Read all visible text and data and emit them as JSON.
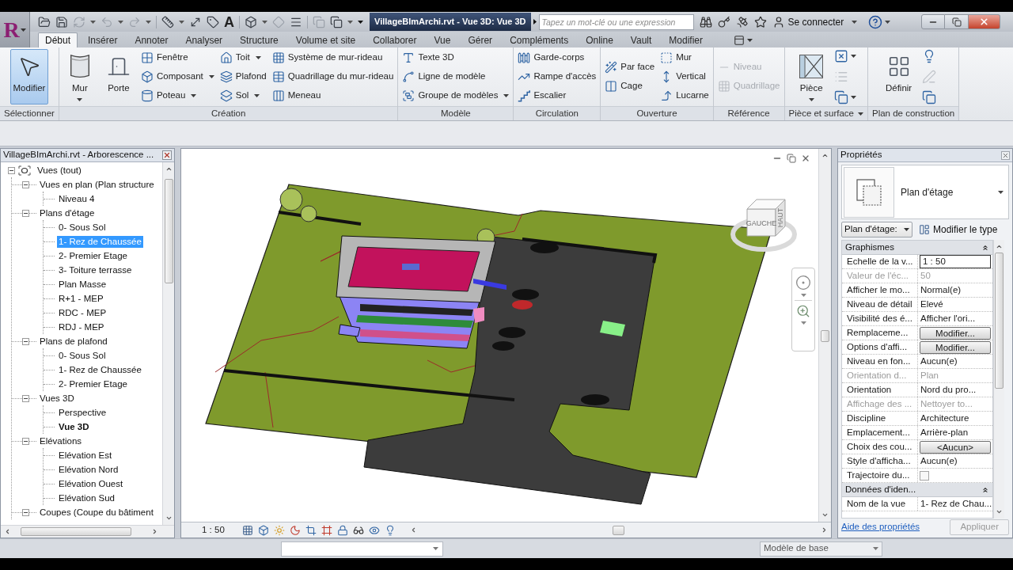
{
  "app_menu": {
    "logo": "R"
  },
  "quick_access": {
    "text_tool": "A"
  },
  "title_bar": {
    "title": "VillageBImArchi.rvt - Vue 3D: Vue 3D",
    "search": {
      "placeholder": "Tapez un mot-clé ou une expression"
    },
    "sign_in": "Se connecter"
  },
  "ribbon": {
    "tabs": [
      {
        "label": "Début",
        "selected": true
      },
      {
        "label": "Insérer",
        "selected": false
      },
      {
        "label": "Annoter",
        "selected": false
      },
      {
        "label": "Analyser",
        "selected": false
      },
      {
        "label": "Structure",
        "selected": false
      },
      {
        "label": "Volume et site",
        "selected": false
      },
      {
        "label": "Collaborer",
        "selected": false
      },
      {
        "label": "Vue",
        "selected": false
      },
      {
        "label": "Gérer",
        "selected": false
      },
      {
        "label": "Compléments",
        "selected": false
      },
      {
        "label": "Online",
        "selected": false
      },
      {
        "label": "Vault",
        "selected": false
      },
      {
        "label": "Modifier",
        "selected": false
      }
    ],
    "panels": [
      {
        "title": "Sélectionner",
        "menu": false,
        "columns": [
          {
            "kind": "large",
            "items": [
              {
                "label": "Modifier",
                "dropdown": false,
                "active": true
              }
            ]
          }
        ]
      },
      {
        "title": "Création",
        "menu": false,
        "columns": [
          {
            "kind": "large",
            "items": [
              {
                "label": "Mur",
                "dropdown": true,
                "active": false
              }
            ]
          },
          {
            "kind": "large",
            "items": [
              {
                "label": "Porte",
                "dropdown": false,
                "active": false
              }
            ]
          },
          {
            "kind": "small",
            "items": [
              {
                "label": "Fenêtre",
                "dropdown": false,
                "disabled": false
              },
              {
                "label": "Composant",
                "dropdown": true,
                "disabled": false
              },
              {
                "label": "Poteau",
                "dropdown": true,
                "disabled": false
              }
            ]
          },
          {
            "kind": "small",
            "items": [
              {
                "label": "Toit",
                "dropdown": true,
                "disabled": false
              },
              {
                "label": "Plafond",
                "dropdown": false,
                "disabled": false
              },
              {
                "label": "Sol",
                "dropdown": true,
                "disabled": false
              }
            ]
          },
          {
            "kind": "small",
            "items": [
              {
                "label": "Système de mur-rideau",
                "dropdown": false,
                "disabled": false
              },
              {
                "label": "Quadrillage du mur-rideau",
                "dropdown": false,
                "disabled": false
              },
              {
                "label": "Meneau",
                "dropdown": false,
                "disabled": false
              }
            ]
          }
        ]
      },
      {
        "title": "Modèle",
        "menu": false,
        "columns": [
          {
            "kind": "small",
            "items": [
              {
                "label": "Texte 3D",
                "dropdown": false,
                "disabled": false
              },
              {
                "label": "Ligne de modèle",
                "dropdown": false,
                "disabled": false
              },
              {
                "label": "Groupe de modèles",
                "dropdown": true,
                "disabled": false
              }
            ]
          }
        ]
      },
      {
        "title": "Circulation",
        "menu": false,
        "columns": [
          {
            "kind": "small",
            "items": [
              {
                "label": "Garde-corps",
                "dropdown": false,
                "disabled": false
              },
              {
                "label": "Rampe d'accès",
                "dropdown": false,
                "disabled": false
              },
              {
                "label": "Escalier",
                "dropdown": false,
                "disabled": false
              }
            ]
          }
        ]
      },
      {
        "title": "Ouverture",
        "menu": false,
        "columns": [
          {
            "kind": "small",
            "items": [
              {
                "label": "Par face",
                "dropdown": false,
                "disabled": false
              },
              {
                "label": "Cage",
                "dropdown": false,
                "disabled": false
              }
            ]
          },
          {
            "kind": "small",
            "items": [
              {
                "label": "Mur",
                "dropdown": false,
                "disabled": false
              },
              {
                "label": "Vertical",
                "dropdown": false,
                "disabled": false
              },
              {
                "label": "Lucarne",
                "dropdown": false,
                "disabled": false
              }
            ]
          }
        ]
      },
      {
        "title": "Référence",
        "menu": false,
        "columns": [
          {
            "kind": "small",
            "items": [
              {
                "label": "Niveau",
                "dropdown": false,
                "disabled": true
              },
              {
                "label": "Quadrillage",
                "dropdown": false,
                "disabled": true
              }
            ]
          }
        ]
      },
      {
        "title": "Pièce et surface",
        "menu": true,
        "columns": [
          {
            "kind": "large",
            "items": [
              {
                "label": "Pièce",
                "dropdown": true,
                "active": false
              }
            ]
          },
          {
            "kind": "icon",
            "items": [
              {
                "dropdown": true,
                "disabled": false
              },
              {
                "dropdown": false,
                "disabled": true
              },
              {
                "dropdown": true,
                "disabled": false
              }
            ]
          }
        ]
      },
      {
        "title": "Plan de construction",
        "menu": false,
        "columns": [
          {
            "kind": "large",
            "items": [
              {
                "label": "Définir",
                "dropdown": false,
                "active": false
              }
            ]
          },
          {
            "kind": "icon",
            "items": [
              {
                "dropdown": false,
                "disabled": false
              },
              {
                "dropdown": false,
                "disabled": true
              },
              {
                "dropdown": false,
                "disabled": false
              }
            ]
          }
        ]
      }
    ]
  },
  "project_browser": {
    "title": "VillageBImArchi.rvt - Arborescence ...",
    "tree": [
      {
        "label": "Vues (tout)",
        "expanded": true,
        "selected": false,
        "current": false,
        "children": [
          {
            "label": "Vues en plan (Plan structure",
            "expanded": true,
            "selected": false,
            "current": false,
            "children": [
              {
                "label": "Niveau 4",
                "selected": false,
                "current": false
              }
            ]
          },
          {
            "label": "Plans d'étage",
            "expanded": true,
            "selected": false,
            "current": false,
            "children": [
              {
                "label": "0- Sous Sol",
                "selected": false,
                "current": false
              },
              {
                "label": "1- Rez de Chaussée",
                "selected": true,
                "current": false
              },
              {
                "label": "2- Premier Etage",
                "selected": false,
                "current": false
              },
              {
                "label": "3- Toiture terrasse",
                "selected": false,
                "current": false
              },
              {
                "label": "Plan Masse",
                "selected": false,
                "current": false
              },
              {
                "label": "R+1 - MEP",
                "selected": false,
                "current": false
              },
              {
                "label": "RDC - MEP",
                "selected": false,
                "current": false
              },
              {
                "label": "RDJ - MEP",
                "selected": false,
                "current": false
              }
            ]
          },
          {
            "label": "Plans de plafond",
            "expanded": true,
            "selected": false,
            "current": false,
            "children": [
              {
                "label": "0- Sous Sol",
                "selected": false,
                "current": false
              },
              {
                "label": "1- Rez de Chaussée",
                "selected": false,
                "current": false
              },
              {
                "label": "2- Premier Etage",
                "selected": false,
                "current": false
              }
            ]
          },
          {
            "label": "Vues 3D",
            "expanded": true,
            "selected": false,
            "current": false,
            "children": [
              {
                "label": "Perspective",
                "selected": false,
                "current": false
              },
              {
                "label": "Vue 3D",
                "selected": false,
                "current": true
              }
            ]
          },
          {
            "label": "Elévations",
            "expanded": true,
            "selected": false,
            "current": false,
            "children": [
              {
                "label": "Elévation Est",
                "selected": false,
                "current": false
              },
              {
                "label": "Elévation Nord",
                "selected": false,
                "current": false
              },
              {
                "label": "Elévation Ouest",
                "selected": false,
                "current": false
              },
              {
                "label": "Elévation Sud",
                "selected": false,
                "current": false
              }
            ]
          },
          {
            "label": "Coupes (Coupe du bâtiment",
            "expanded": true,
            "selected": false,
            "current": false
          }
        ]
      }
    ]
  },
  "view": {
    "view_cube": {
      "front": "GAUCHE",
      "top": "HAUT"
    },
    "scale": "1 : 50"
  },
  "properties": {
    "title": "Propriétés",
    "type_selector": "Plan d'étage",
    "type_filter": "Plan d'étage:",
    "edit_type": "Modifier le type",
    "groups": [
      {
        "title": "Graphismes",
        "expanded": true,
        "rows": [
          {
            "label": "Echelle de la v...",
            "value": "1 : 50",
            "kind": "input",
            "disabled": false
          },
          {
            "label": "Valeur de l'éc...",
            "value": "50",
            "kind": "text",
            "disabled": true
          },
          {
            "label": "Afficher le mo...",
            "value": "Normal(e)",
            "kind": "text",
            "disabled": false
          },
          {
            "label": "Niveau de détail",
            "value": "Elevé",
            "kind": "text",
            "disabled": false
          },
          {
            "label": "Visibilité des é...",
            "value": "Afficher l'ori...",
            "kind": "text",
            "disabled": false
          },
          {
            "label": "Remplaceme...",
            "value": "Modifier...",
            "kind": "button",
            "disabled": false
          },
          {
            "label": "Options d'affi...",
            "value": "Modifier...",
            "kind": "button",
            "disabled": false
          },
          {
            "label": "Niveau en fon...",
            "value": "Aucun(e)",
            "kind": "text",
            "disabled": false
          },
          {
            "label": "Orientation d...",
            "value": "Plan",
            "kind": "text",
            "disabled": true
          },
          {
            "label": "Orientation",
            "value": "Nord du pro...",
            "kind": "text",
            "disabled": false
          },
          {
            "label": "Affichage des ...",
            "value": "Nettoyer to...",
            "kind": "text",
            "disabled": true
          },
          {
            "label": "Discipline",
            "value": "Architecture",
            "kind": "text",
            "disabled": false
          },
          {
            "label": "Emplacement...",
            "value": "Arrière-plan",
            "kind": "text",
            "disabled": false
          },
          {
            "label": "Choix des cou...",
            "value": "<Aucun>",
            "kind": "button",
            "disabled": false
          },
          {
            "label": "Style d'afficha...",
            "value": "Aucun(e)",
            "kind": "text",
            "disabled": false
          },
          {
            "label": "Trajectoire du...",
            "kind": "checkbox",
            "checked": false,
            "disabled": false
          }
        ]
      },
      {
        "title": "Données d'iden...",
        "expanded": true,
        "rows": [
          {
            "label": "Nom de la vue",
            "value": "1- Rez de Chau...",
            "kind": "text",
            "disabled": false
          }
        ]
      }
    ],
    "help_link": "Aide des propriétés",
    "apply": {
      "label": "Appliquer",
      "disabled": true
    }
  },
  "status_bar": {
    "workset": "Modèle de base"
  }
}
